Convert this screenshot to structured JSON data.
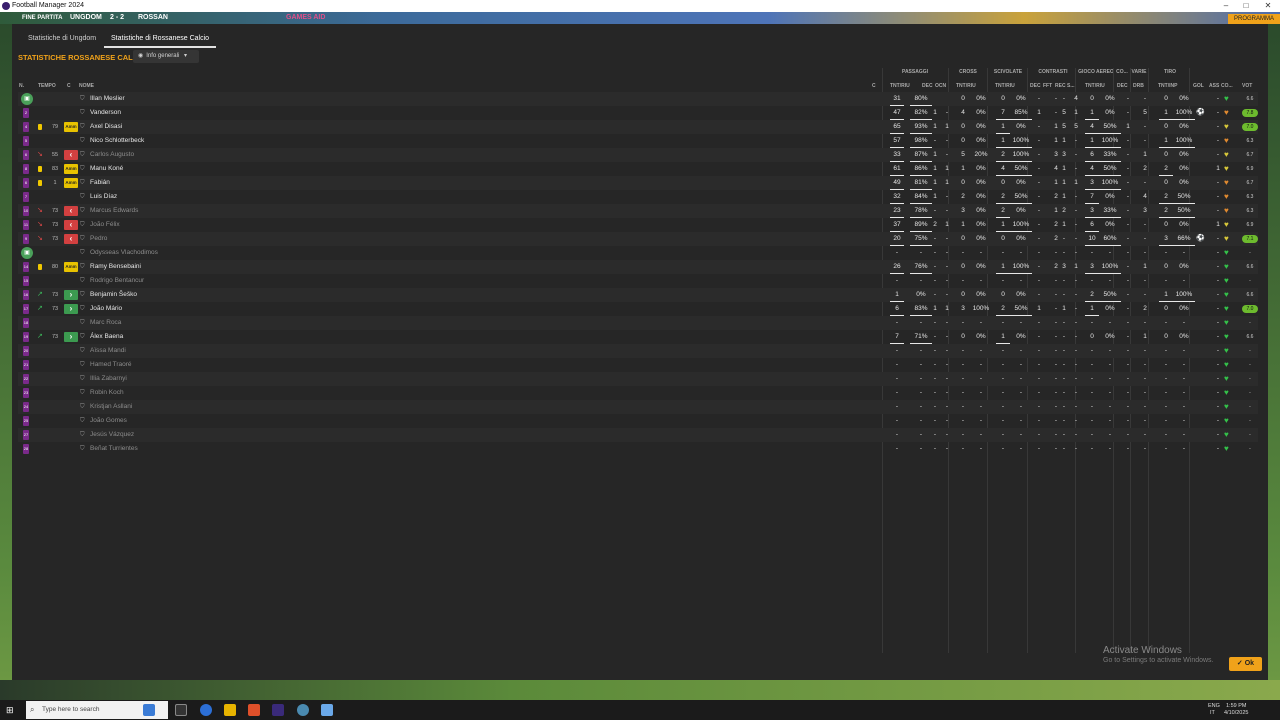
{
  "window": {
    "title": "Football Manager 2024",
    "minimize": "–",
    "maximize": "□",
    "close": "✕"
  },
  "banner": {
    "status": "FINE PARTITA",
    "home": "UNGDOM",
    "score": "2 - 2",
    "away": "ROSSAN",
    "ad": "GAMES AID",
    "right_ad": "PROGRAMMA"
  },
  "tabs": [
    {
      "label": "Statistiche di Ungdom"
    },
    {
      "label": "Statistiche di Rossanese Calcio"
    }
  ],
  "section_title": "STATISTICHE ROSSANESE CALCIO",
  "view_select": {
    "icon": "eye-icon",
    "label": "Info generali",
    "chevron": "▾"
  },
  "groups": [
    "PASSAGGI",
    "CROSS",
    "SCIVOLATE",
    "CONTRASTI",
    "GIOCO AEREO",
    "CO...",
    "VARIE",
    "TIRO"
  ],
  "columns": {
    "n": "N.",
    "tempo": "TEMPO",
    "c": "C",
    "nome": "NOME",
    "c2": "C",
    "p_tnt": "TNT/RIU",
    "dec": "DEC",
    "occ": "OCN",
    "cr_tnt": "TNT/RIU",
    "sc_tnt": "TNT/RIU",
    "ct_dec": "DEC",
    "ct_fft": "FFT",
    "ct_rec": "REC",
    "ct_s": "S...",
    "ga_tnt": "TNT/RIU",
    "co_dec": "DEC",
    "va_drb": "DRB",
    "ti_tnt": "TNT/INP",
    "gol": "GOL",
    "ass": "ASS",
    "co": "CO...",
    "vot": "VOT"
  },
  "rows": [
    {
      "num": "",
      "gk": true,
      "name": "Illan Meslier",
      "card": "",
      "sub": "",
      "min": "",
      "badge": "",
      "p1": "31",
      "p2": "80%",
      "dec": "",
      "occ": "",
      "cr1": "0",
      "cr2": "0%",
      "sc1": "0",
      "sc2": "0%",
      "ct1": "-",
      "ct2": "-",
      "ct3": "-",
      "ct4": "4",
      "ga1": "0",
      "ga2": "0%",
      "co": "-",
      "drb": "-",
      "ti1": "0",
      "ti2": "0%",
      "gol": "",
      "ass": "-",
      "heart": "g",
      "vot": "6.6",
      "dim": false
    },
    {
      "num": "2",
      "gk": false,
      "name": "Vanderson",
      "card": "",
      "sub": "",
      "min": "",
      "badge": "",
      "p1": "47",
      "p2": "82%",
      "dec": "1",
      "occ": "-",
      "cr1": "4",
      "cr2": "0%",
      "sc1": "7",
      "sc2": "85%",
      "ct1": "1",
      "ct2": "-",
      "ct3": "5",
      "ct4": "1",
      "ga1": "1",
      "ga2": "0%",
      "co": "-",
      "drb": "5",
      "ti1": "1",
      "ti2": "100%",
      "gol": "⚽",
      "ass": "-",
      "heart": "o",
      "vot": "7.8",
      "dim": false
    },
    {
      "num": "4",
      "gk": false,
      "name": "Axel Disasi",
      "card": "y",
      "sub": "",
      "min": "79",
      "badge": "Amm",
      "p1": "65",
      "p2": "93%",
      "dec": "1",
      "occ": "1",
      "cr1": "0",
      "cr2": "0%",
      "sc1": "1",
      "sc2": "0%",
      "ct1": "-",
      "ct2": "1",
      "ct3": "5",
      "ct4": "5",
      "ga1": "4",
      "ga2": "50%",
      "co": "1",
      "drb": "-",
      "ti1": "0",
      "ti2": "0%",
      "gol": "",
      "ass": "-",
      "heart": "y",
      "vot": "7.0",
      "dim": false
    },
    {
      "num": "5",
      "gk": false,
      "name": "Nico Schlotterbeck",
      "card": "",
      "sub": "",
      "min": "",
      "badge": "",
      "p1": "57",
      "p2": "98%",
      "dec": "-",
      "occ": "-",
      "cr1": "0",
      "cr2": "0%",
      "sc1": "1",
      "sc2": "100%",
      "ct1": "-",
      "ct2": "1",
      "ct3": "1",
      "ct4": "-",
      "ga1": "1",
      "ga2": "100%",
      "co": "-",
      "drb": "-",
      "ti1": "1",
      "ti2": "100%",
      "gol": "",
      "ass": "-",
      "heart": "o",
      "vot": "6.3",
      "dim": false
    },
    {
      "num": "6",
      "gk": false,
      "name": "Carlos Augusto",
      "card": "",
      "sub": "out",
      "min": "55",
      "badge": "out",
      "p1": "33",
      "p2": "87%",
      "dec": "1",
      "occ": "-",
      "cr1": "5",
      "cr2": "20%",
      "sc1": "2",
      "sc2": "100%",
      "ct1": "-",
      "ct2": "3",
      "ct3": "3",
      "ct4": "-",
      "ga1": "6",
      "ga2": "33%",
      "co": "-",
      "drb": "1",
      "ti1": "0",
      "ti2": "0%",
      "gol": "",
      "ass": "-",
      "heart": "y",
      "vot": "6.7",
      "dim": true
    },
    {
      "num": "8",
      "gk": false,
      "name": "Manu Koné",
      "card": "y",
      "sub": "",
      "min": "83",
      "badge": "Amm",
      "p1": "61",
      "p2": "86%",
      "dec": "1",
      "occ": "1",
      "cr1": "1",
      "cr2": "0%",
      "sc1": "4",
      "sc2": "50%",
      "ct1": "-",
      "ct2": "4",
      "ct3": "1",
      "ct4": "-",
      "ga1": "4",
      "ga2": "50%",
      "co": "-",
      "drb": "2",
      "ti1": "2",
      "ti2": "0%",
      "gol": "",
      "ass": "1",
      "heart": "y",
      "vot": "6.9",
      "dim": false
    },
    {
      "num": "6",
      "gk": false,
      "name": "Fabián",
      "card": "y",
      "sub": "",
      "min": "1",
      "badge": "Amm",
      "p1": "49",
      "p2": "81%",
      "dec": "1",
      "occ": "1",
      "cr1": "0",
      "cr2": "0%",
      "sc1": "0",
      "sc2": "0%",
      "ct1": "-",
      "ct2": "1",
      "ct3": "1",
      "ct4": "1",
      "ga1": "3",
      "ga2": "100%",
      "co": "-",
      "drb": "-",
      "ti1": "0",
      "ti2": "0%",
      "gol": "",
      "ass": "-",
      "heart": "o",
      "vot": "6.7",
      "dim": false
    },
    {
      "num": "7",
      "gk": false,
      "name": "Luis Díaz",
      "card": "",
      "sub": "",
      "min": "",
      "badge": "",
      "p1": "32",
      "p2": "84%",
      "dec": "1",
      "occ": "-",
      "cr1": "2",
      "cr2": "0%",
      "sc1": "2",
      "sc2": "50%",
      "ct1": "-",
      "ct2": "2",
      "ct3": "1",
      "ct4": "-",
      "ga1": "7",
      "ga2": "0%",
      "co": "-",
      "drb": "4",
      "ti1": "2",
      "ti2": "50%",
      "gol": "",
      "ass": "-",
      "heart": "o",
      "vot": "6.3",
      "dim": false
    },
    {
      "num": "10",
      "gk": false,
      "name": "Marcus Edwards",
      "card": "",
      "sub": "out",
      "min": "73",
      "badge": "out",
      "p1": "23",
      "p2": "78%",
      "dec": "-",
      "occ": "-",
      "cr1": "3",
      "cr2": "0%",
      "sc1": "2",
      "sc2": "0%",
      "ct1": "-",
      "ct2": "1",
      "ct3": "2",
      "ct4": "-",
      "ga1": "3",
      "ga2": "33%",
      "co": "-",
      "drb": "3",
      "ti1": "2",
      "ti2": "50%",
      "gol": "",
      "ass": "-",
      "heart": "o",
      "vot": "6.3",
      "dim": true
    },
    {
      "num": "11",
      "gk": false,
      "name": "João Félix",
      "card": "",
      "sub": "out",
      "min": "73",
      "badge": "out",
      "p1": "37",
      "p2": "89%",
      "dec": "2",
      "occ": "1",
      "cr1": "1",
      "cr2": "0%",
      "sc1": "1",
      "sc2": "100%",
      "ct1": "-",
      "ct2": "2",
      "ct3": "1",
      "ct4": "-",
      "ga1": "6",
      "ga2": "0%",
      "co": "-",
      "drb": "-",
      "ti1": "0",
      "ti2": "0%",
      "gol": "",
      "ass": "1",
      "heart": "y",
      "vot": "6.9",
      "dim": true
    },
    {
      "num": "9",
      "gk": false,
      "name": "Pedro",
      "card": "",
      "sub": "out",
      "min": "73",
      "badge": "out",
      "p1": "20",
      "p2": "75%",
      "dec": "-",
      "occ": "-",
      "cr1": "0",
      "cr2": "0%",
      "sc1": "0",
      "sc2": "0%",
      "ct1": "-",
      "ct2": "2",
      "ct3": "-",
      "ct4": "-",
      "ga1": "10",
      "ga2": "60%",
      "co": "-",
      "drb": "-",
      "ti1": "3",
      "ti2": "66%",
      "gol": "⚽",
      "ass": "-",
      "heart": "y",
      "vot": "7.1",
      "dim": true
    },
    {
      "num": "",
      "gk": true,
      "name": "Odysseas Vlachodimos",
      "card": "",
      "sub": "",
      "min": "",
      "badge": "",
      "p1": "-",
      "p2": "-",
      "dec": "-",
      "occ": "-",
      "cr1": "-",
      "cr2": "-",
      "sc1": "-",
      "sc2": "-",
      "ct1": "-",
      "ct2": "-",
      "ct3": "-",
      "ct4": "-",
      "ga1": "-",
      "ga2": "-",
      "co": "-",
      "drb": "-",
      "ti1": "-",
      "ti2": "-",
      "gol": "",
      "ass": "-",
      "heart": "g",
      "vot": "-",
      "dim": true
    },
    {
      "num": "14",
      "gk": false,
      "name": "Ramy Bensebaini",
      "card": "y",
      "sub": "",
      "min": "80",
      "badge": "Amm",
      "p1": "26",
      "p2": "76%",
      "dec": "-",
      "occ": "-",
      "cr1": "0",
      "cr2": "0%",
      "sc1": "1",
      "sc2": "100%",
      "ct1": "-",
      "ct2": "2",
      "ct3": "3",
      "ct4": "1",
      "ga1": "3",
      "ga2": "100%",
      "co": "-",
      "drb": "1",
      "ti1": "0",
      "ti2": "0%",
      "gol": "",
      "ass": "-",
      "heart": "g",
      "vot": "6.6",
      "dim": false
    },
    {
      "num": "15",
      "gk": false,
      "name": "Rodrigo Bentancur",
      "card": "",
      "sub": "",
      "min": "",
      "badge": "",
      "p1": "-",
      "p2": "-",
      "dec": "-",
      "occ": "-",
      "cr1": "-",
      "cr2": "-",
      "sc1": "-",
      "sc2": "-",
      "ct1": "-",
      "ct2": "-",
      "ct3": "-",
      "ct4": "-",
      "ga1": "-",
      "ga2": "-",
      "co": "-",
      "drb": "-",
      "ti1": "-",
      "ti2": "-",
      "gol": "",
      "ass": "-",
      "heart": "g",
      "vot": "-",
      "dim": true
    },
    {
      "num": "16",
      "gk": false,
      "name": "Benjamin Šeško",
      "card": "",
      "sub": "in",
      "min": "73",
      "badge": "in",
      "p1": "1",
      "p2": "0%",
      "dec": "-",
      "occ": "-",
      "cr1": "0",
      "cr2": "0%",
      "sc1": "0",
      "sc2": "0%",
      "ct1": "-",
      "ct2": "-",
      "ct3": "-",
      "ct4": "-",
      "ga1": "2",
      "ga2": "50%",
      "co": "-",
      "drb": "-",
      "ti1": "1",
      "ti2": "100%",
      "gol": "",
      "ass": "-",
      "heart": "g",
      "vot": "6.6",
      "dim": false
    },
    {
      "num": "17",
      "gk": false,
      "name": "João Mário",
      "card": "",
      "sub": "in",
      "min": "73",
      "badge": "in",
      "p1": "6",
      "p2": "83%",
      "dec": "1",
      "occ": "1",
      "cr1": "3",
      "cr2": "100%",
      "sc1": "2",
      "sc2": "50%",
      "ct1": "1",
      "ct2": "-",
      "ct3": "1",
      "ct4": "-",
      "ga1": "1",
      "ga2": "0%",
      "co": "-",
      "drb": "2",
      "ti1": "0",
      "ti2": "0%",
      "gol": "",
      "ass": "-",
      "heart": "g",
      "vot": "7.0",
      "dim": false
    },
    {
      "num": "18",
      "gk": false,
      "name": "Marc Roca",
      "card": "",
      "sub": "",
      "min": "",
      "badge": "",
      "p1": "-",
      "p2": "-",
      "dec": "-",
      "occ": "-",
      "cr1": "-",
      "cr2": "-",
      "sc1": "-",
      "sc2": "-",
      "ct1": "-",
      "ct2": "-",
      "ct3": "-",
      "ct4": "-",
      "ga1": "-",
      "ga2": "-",
      "co": "-",
      "drb": "-",
      "ti1": "-",
      "ti2": "-",
      "gol": "",
      "ass": "-",
      "heart": "g",
      "vot": "-",
      "dim": true
    },
    {
      "num": "19",
      "gk": false,
      "name": "Álex Baena",
      "card": "",
      "sub": "in",
      "min": "73",
      "badge": "in",
      "p1": "7",
      "p2": "71%",
      "dec": "-",
      "occ": "-",
      "cr1": "0",
      "cr2": "0%",
      "sc1": "1",
      "sc2": "0%",
      "ct1": "-",
      "ct2": "-",
      "ct3": "-",
      "ct4": "-",
      "ga1": "0",
      "ga2": "0%",
      "co": "-",
      "drb": "1",
      "ti1": "0",
      "ti2": "0%",
      "gol": "",
      "ass": "-",
      "heart": "g",
      "vot": "6.6",
      "dim": false
    },
    {
      "num": "20",
      "gk": false,
      "name": "Aïssa Mandi",
      "card": "",
      "sub": "",
      "min": "",
      "badge": "",
      "p1": "-",
      "p2": "-",
      "dec": "-",
      "occ": "-",
      "cr1": "-",
      "cr2": "-",
      "sc1": "-",
      "sc2": "-",
      "ct1": "-",
      "ct2": "-",
      "ct3": "-",
      "ct4": "-",
      "ga1": "-",
      "ga2": "-",
      "co": "-",
      "drb": "-",
      "ti1": "-",
      "ti2": "-",
      "gol": "",
      "ass": "-",
      "heart": "g",
      "vot": "-",
      "dim": true
    },
    {
      "num": "21",
      "gk": false,
      "name": "Hamed Traoré",
      "card": "",
      "sub": "",
      "min": "",
      "badge": "",
      "p1": "-",
      "p2": "-",
      "dec": "-",
      "occ": "-",
      "cr1": "-",
      "cr2": "-",
      "sc1": "-",
      "sc2": "-",
      "ct1": "-",
      "ct2": "-",
      "ct3": "-",
      "ct4": "-",
      "ga1": "-",
      "ga2": "-",
      "co": "-",
      "drb": "-",
      "ti1": "-",
      "ti2": "-",
      "gol": "",
      "ass": "-",
      "heart": "g",
      "vot": "-",
      "dim": true
    },
    {
      "num": "22",
      "gk": false,
      "name": "Illia Zabarnyi",
      "card": "",
      "sub": "",
      "min": "",
      "badge": "",
      "p1": "-",
      "p2": "-",
      "dec": "-",
      "occ": "-",
      "cr1": "-",
      "cr2": "-",
      "sc1": "-",
      "sc2": "-",
      "ct1": "-",
      "ct2": "-",
      "ct3": "-",
      "ct4": "-",
      "ga1": "-",
      "ga2": "-",
      "co": "-",
      "drb": "-",
      "ti1": "-",
      "ti2": "-",
      "gol": "",
      "ass": "-",
      "heart": "g",
      "vot": "-",
      "dim": true
    },
    {
      "num": "23",
      "gk": false,
      "name": "Robin Koch",
      "card": "",
      "sub": "",
      "min": "",
      "badge": "",
      "p1": "-",
      "p2": "-",
      "dec": "-",
      "occ": "-",
      "cr1": "-",
      "cr2": "-",
      "sc1": "-",
      "sc2": "-",
      "ct1": "-",
      "ct2": "-",
      "ct3": "-",
      "ct4": "-",
      "ga1": "-",
      "ga2": "-",
      "co": "-",
      "drb": "-",
      "ti1": "-",
      "ti2": "-",
      "gol": "",
      "ass": "-",
      "heart": "g",
      "vot": "-",
      "dim": true
    },
    {
      "num": "24",
      "gk": false,
      "name": "Kristjan Asllani",
      "card": "",
      "sub": "",
      "min": "",
      "badge": "",
      "p1": "-",
      "p2": "-",
      "dec": "-",
      "occ": "-",
      "cr1": "-",
      "cr2": "-",
      "sc1": "-",
      "sc2": "-",
      "ct1": "-",
      "ct2": "-",
      "ct3": "-",
      "ct4": "-",
      "ga1": "-",
      "ga2": "-",
      "co": "-",
      "drb": "-",
      "ti1": "-",
      "ti2": "-",
      "gol": "",
      "ass": "-",
      "heart": "g",
      "vot": "-",
      "dim": true
    },
    {
      "num": "25",
      "gk": false,
      "name": "João Gomes",
      "card": "",
      "sub": "",
      "min": "",
      "badge": "",
      "p1": "-",
      "p2": "-",
      "dec": "-",
      "occ": "-",
      "cr1": "-",
      "cr2": "-",
      "sc1": "-",
      "sc2": "-",
      "ct1": "-",
      "ct2": "-",
      "ct3": "-",
      "ct4": "-",
      "ga1": "-",
      "ga2": "-",
      "co": "-",
      "drb": "-",
      "ti1": "-",
      "ti2": "-",
      "gol": "",
      "ass": "-",
      "heart": "g",
      "vot": "-",
      "dim": true
    },
    {
      "num": "27",
      "gk": false,
      "name": "Jesús Vázquez",
      "card": "",
      "sub": "",
      "min": "",
      "badge": "",
      "p1": "-",
      "p2": "-",
      "dec": "-",
      "occ": "-",
      "cr1": "-",
      "cr2": "-",
      "sc1": "-",
      "sc2": "-",
      "ct1": "-",
      "ct2": "-",
      "ct3": "-",
      "ct4": "-",
      "ga1": "-",
      "ga2": "-",
      "co": "-",
      "drb": "-",
      "ti1": "-",
      "ti2": "-",
      "gol": "",
      "ass": "-",
      "heart": "g",
      "vot": "-",
      "dim": true
    },
    {
      "num": "28",
      "gk": false,
      "name": "Beñat Turrientes",
      "card": "",
      "sub": "",
      "min": "",
      "badge": "",
      "p1": "-",
      "p2": "-",
      "dec": "-",
      "occ": "-",
      "cr1": "-",
      "cr2": "-",
      "sc1": "-",
      "sc2": "-",
      "ct1": "-",
      "ct2": "-",
      "ct3": "-",
      "ct4": "-",
      "ga1": "-",
      "ga2": "-",
      "co": "-",
      "drb": "-",
      "ti1": "-",
      "ti2": "-",
      "gol": "",
      "ass": "-",
      "heart": "g",
      "vot": "-",
      "dim": true
    }
  ],
  "watermark": {
    "line1": "Activate Windows",
    "line2": "Go to Settings to activate Windows."
  },
  "ok_button": {
    "label": "✓ Ok"
  },
  "taskbar": {
    "search_placeholder": "Type here to search",
    "lang": "ENG",
    "region": "IT",
    "time": "1:59 PM",
    "date": "4/10/2025"
  },
  "colors": {
    "accent": "#f0a21a",
    "panel": "#262626",
    "positive": "#34c24a",
    "negative": "#d24040"
  }
}
